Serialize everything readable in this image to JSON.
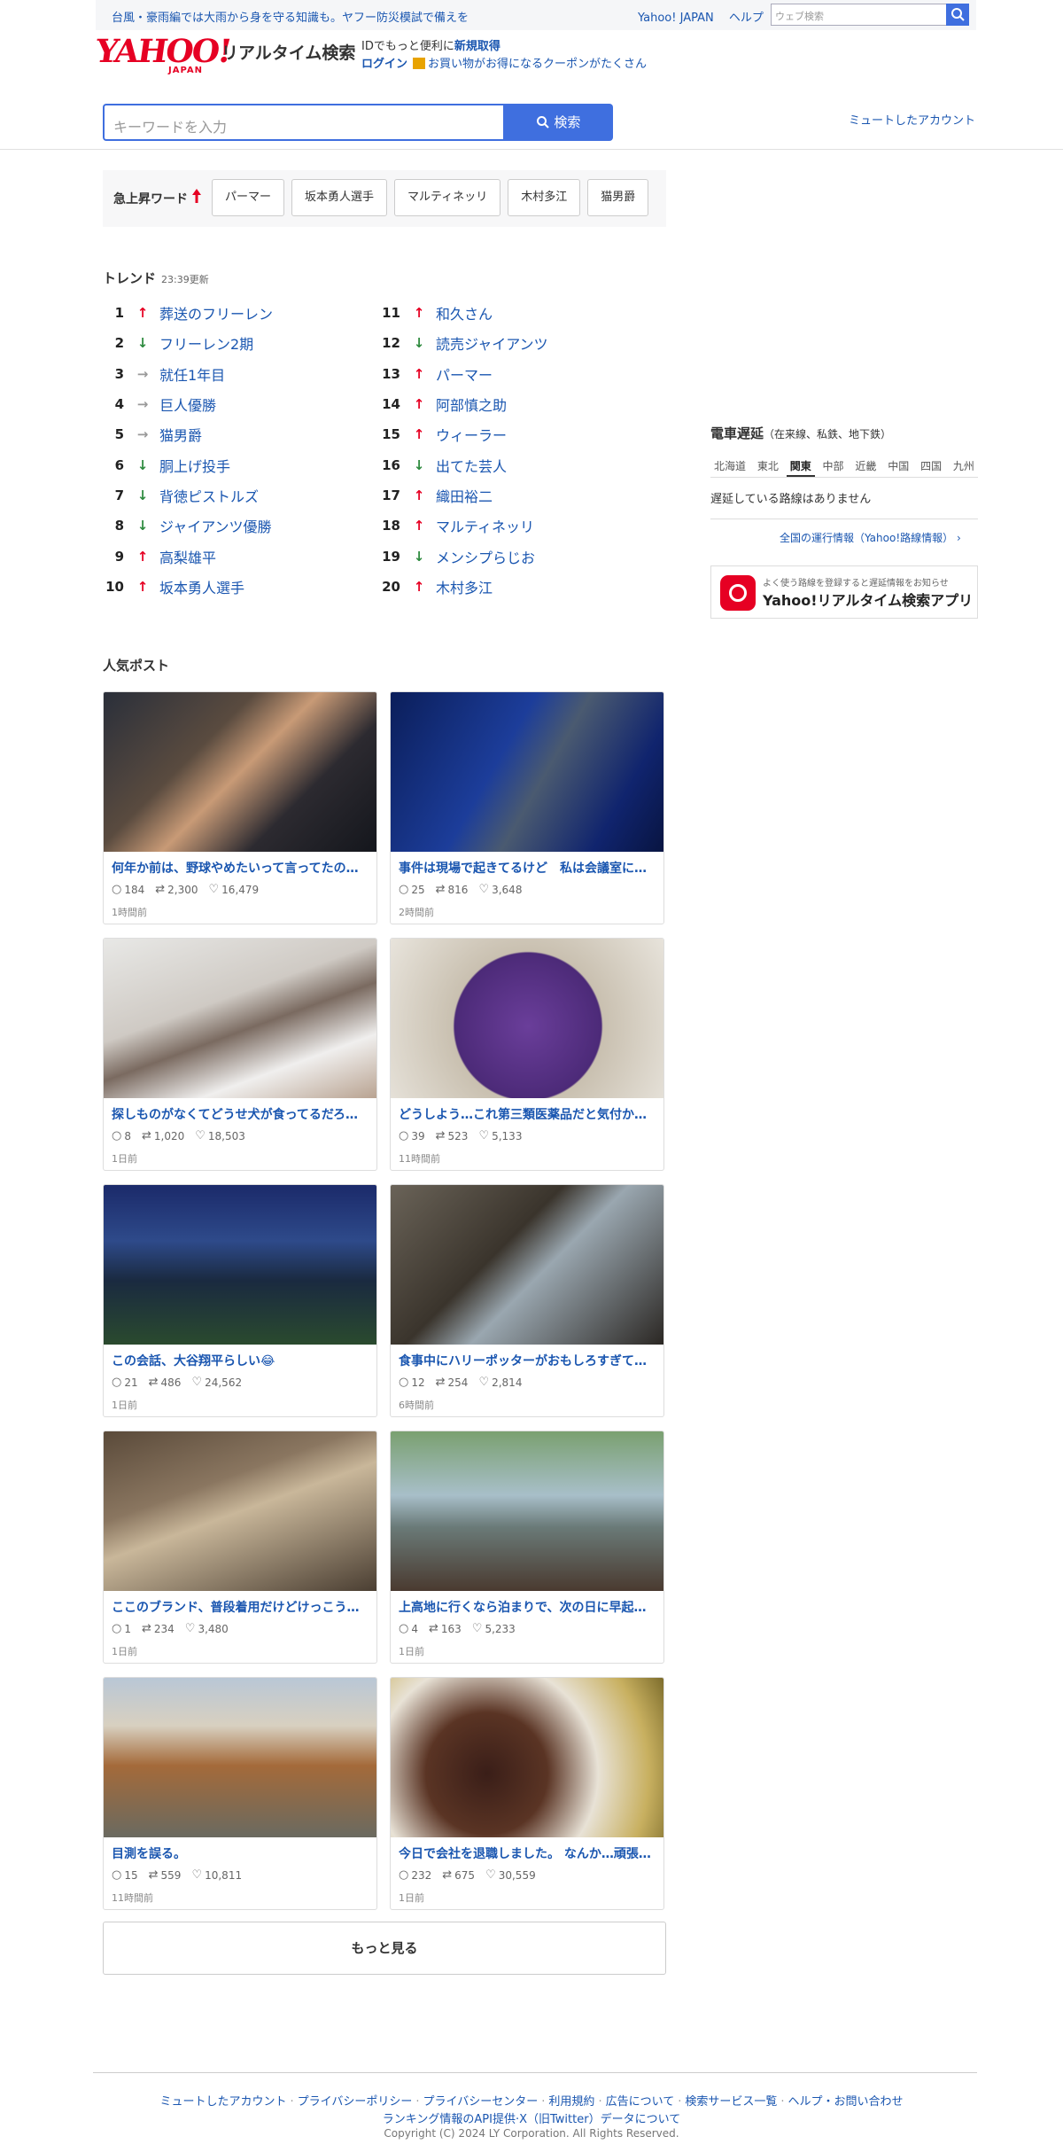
{
  "notice": {
    "text": "台風・豪雨編では大雨から身を守る知識も。ヤフー防災模試で備えを",
    "links": [
      "Yahoo! JAPAN",
      "ヘルプ"
    ],
    "web_search_placeholder": "ウェブ検索"
  },
  "logo": {
    "yahoo": "YAHOO!",
    "japan": "JAPAN",
    "service": "リアルタイム検索"
  },
  "account": {
    "line1_prefix": "IDでもっと便利に",
    "signup": "新規取得",
    "login": "ログイン",
    "coupon": "お買い物がお得になるクーポンがたくさん"
  },
  "search": {
    "placeholder": "キーワードを入力",
    "button": "検索",
    "muted_accounts": "ミュートしたアカウント"
  },
  "rising": {
    "label": "急上昇ワード",
    "items": [
      "パーマー",
      "坂本勇人選手",
      "マルティネッリ",
      "木村多江",
      "猫男爵"
    ]
  },
  "trend": {
    "title": "トレンド",
    "updated": "23:39更新",
    "items": [
      {
        "rank": "1",
        "dir": "up",
        "word": "葬送のフリーレン"
      },
      {
        "rank": "2",
        "dir": "down",
        "word": "フリーレン2期"
      },
      {
        "rank": "3",
        "dir": "same",
        "word": "就任1年目"
      },
      {
        "rank": "4",
        "dir": "same",
        "word": "巨人優勝"
      },
      {
        "rank": "5",
        "dir": "same",
        "word": "猫男爵"
      },
      {
        "rank": "6",
        "dir": "down",
        "word": "胴上げ投手"
      },
      {
        "rank": "7",
        "dir": "down",
        "word": "背徳ピストルズ"
      },
      {
        "rank": "8",
        "dir": "down",
        "word": "ジャイアンツ優勝"
      },
      {
        "rank": "9",
        "dir": "up",
        "word": "高梨雄平"
      },
      {
        "rank": "10",
        "dir": "up",
        "word": "坂本勇人選手"
      },
      {
        "rank": "11",
        "dir": "up",
        "word": "和久さん"
      },
      {
        "rank": "12",
        "dir": "down",
        "word": "読売ジャイアンツ"
      },
      {
        "rank": "13",
        "dir": "up",
        "word": "パーマー"
      },
      {
        "rank": "14",
        "dir": "up",
        "word": "阿部慎之助"
      },
      {
        "rank": "15",
        "dir": "up",
        "word": "ウィーラー"
      },
      {
        "rank": "16",
        "dir": "down",
        "word": "出てた芸人"
      },
      {
        "rank": "17",
        "dir": "up",
        "word": "織田裕二"
      },
      {
        "rank": "18",
        "dir": "up",
        "word": "マルティネッリ"
      },
      {
        "rank": "19",
        "dir": "down",
        "word": "メンシプらじお"
      },
      {
        "rank": "20",
        "dir": "up",
        "word": "木村多江"
      }
    ]
  },
  "train": {
    "title": "電車遅延",
    "subtitle": "（在来線、私鉄、地下鉄）",
    "tabs": [
      "北海道",
      "東北",
      "関東",
      "中部",
      "近畿",
      "中国",
      "四国",
      "九州"
    ],
    "active_tab": "関東",
    "status": "遅延している路線はありません",
    "link": "全国の運行情報（Yahoo!路線情報）"
  },
  "app_banner": {
    "small": "よく使う路線を登録すると遅延情報をお知らせ",
    "big": "Yahoo!リアルタイム検索アプリ"
  },
  "posts": {
    "title": "人気ポスト",
    "items": [
      {
        "title": "何年か前は、野球やめたいって言ってたの…",
        "replies": "184",
        "reposts": "2,300",
        "likes": "16,479",
        "time": "1時間前"
      },
      {
        "title": "事件は現場で起きてるけど　私は会議室に…",
        "replies": "25",
        "reposts": "816",
        "likes": "3,648",
        "time": "2時間前"
      },
      {
        "title": "探しものがなくてどうせ犬が食ってるだろ…",
        "replies": "8",
        "reposts": "1,020",
        "likes": "18,503",
        "time": "1日前"
      },
      {
        "title": "どうしよう…これ第三類医薬品だと気付か…",
        "replies": "39",
        "reposts": "523",
        "likes": "5,133",
        "time": "11時間前"
      },
      {
        "title": "この会話、大谷翔平らしい😂",
        "replies": "21",
        "reposts": "486",
        "likes": "24,562",
        "time": "1日前"
      },
      {
        "title": "食事中にハリーポッターがおもしろすぎて…",
        "replies": "12",
        "reposts": "254",
        "likes": "2,814",
        "time": "6時間前"
      },
      {
        "title": "ここのブランド、普段着用だけどけっこう…",
        "replies": "1",
        "reposts": "234",
        "likes": "3,480",
        "time": "1日前"
      },
      {
        "title": "上高地に行くなら泊まりで、次の日に早起…",
        "replies": "4",
        "reposts": "163",
        "likes": "5,233",
        "time": "1日前"
      },
      {
        "title": "目測を誤る。",
        "replies": "15",
        "reposts": "559",
        "likes": "10,811",
        "time": "11時間前"
      },
      {
        "title": "今日で会社を退職しました。 なんか…頑張…",
        "replies": "232",
        "reposts": "675",
        "likes": "30,559",
        "time": "1日前"
      }
    ],
    "more": "もっと見る"
  },
  "footer": {
    "links": [
      "ミュートしたアカウント",
      "プライバシーポリシー",
      "プライバシーセンター",
      "利用規約",
      "広告について",
      "検索サービス一覧",
      "ヘルプ・お問い合わせ"
    ],
    "links2": [
      "ランキング情報のAPI提供",
      "X（旧Twitter）データについて"
    ],
    "copyright": "Copyright (C) 2024 LY Corporation. All Rights Reserved."
  },
  "colors": {
    "accent": "#3f6fdf",
    "link": "#1a56b0",
    "brand": "#e60023",
    "up": "#e60023",
    "down": "#2d8a3e"
  }
}
